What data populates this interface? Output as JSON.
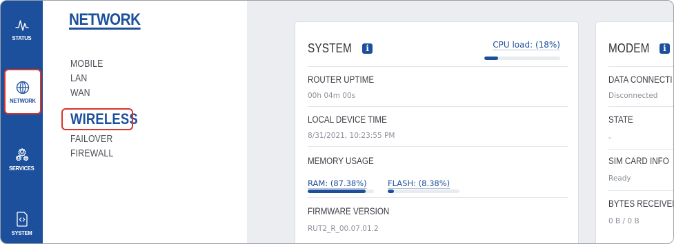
{
  "sidebar": {
    "items": [
      {
        "label": "STATUS",
        "icon": "pulse-icon"
      },
      {
        "label": "NETWORK",
        "icon": "globe-icon"
      },
      {
        "label": "SERVICES",
        "icon": "gears-icon"
      },
      {
        "label": "SYSTEM",
        "icon": "code-file-icon"
      }
    ],
    "active": "NETWORK"
  },
  "submenu": {
    "title": "NETWORK",
    "items": [
      "MOBILE",
      "LAN",
      "WAN",
      "WIRELESS",
      "FAILOVER",
      "FIREWALL"
    ],
    "active": "WIRELESS"
  },
  "system_card": {
    "title": "SYSTEM",
    "cpu_load_text": "CPU load: (18%)",
    "cpu_load_percent": 18,
    "rows": [
      {
        "label": "ROUTER UPTIME",
        "value": "00h 04m 00s"
      },
      {
        "label": "LOCAL DEVICE TIME",
        "value": "8/31/2021, 10:23:55 PM"
      },
      {
        "label": "MEMORY USAGE"
      },
      {
        "label": "FIRMWARE VERSION",
        "value": "RUT2_R_00.07.01.2"
      }
    ],
    "memory": {
      "ram_text": "RAM: (87.38%)",
      "ram_percent": 87.38,
      "flash_text": "FLASH: (8.38%)",
      "flash_percent": 8.38
    }
  },
  "modem_card": {
    "title": "MODEM",
    "rows": [
      {
        "label": "DATA CONNECTI",
        "value": "Disconnected"
      },
      {
        "label": "STATE",
        "value": "-"
      },
      {
        "label": "SIM CARD INFO",
        "value": "Ready"
      },
      {
        "label": "BYTES RECEIVED",
        "value": "0 B / 0 B"
      }
    ]
  },
  "colors": {
    "brand": "#1c4f9c",
    "highlight": "#d8332c",
    "background": "#ebedf0"
  }
}
